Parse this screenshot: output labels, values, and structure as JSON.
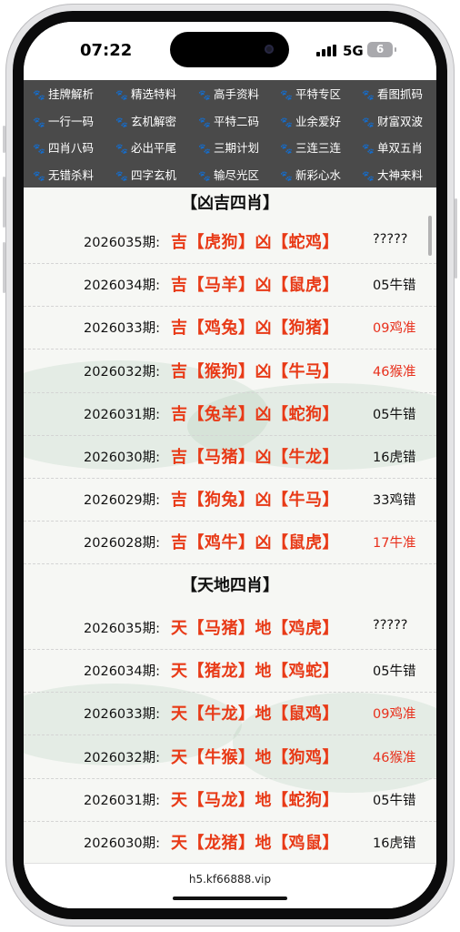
{
  "status_bar": {
    "time": "07:22",
    "network": "5G",
    "battery": "6"
  },
  "nav_menu": [
    [
      "挂牌解析",
      "精选特料",
      "高手资料",
      "平特专区",
      "看图抓码"
    ],
    [
      "一行一码",
      "玄机解密",
      "平特二码",
      "业余爱好",
      "财富双波"
    ],
    [
      "四肖八码",
      "必出平尾",
      "三期计划",
      "三连三连",
      "单双五肖"
    ],
    [
      "无错杀料",
      "四字玄机",
      "输尽光区",
      "新彩心水",
      "大神来料"
    ]
  ],
  "sections": [
    {
      "title": "【凶吉四肖】",
      "rows": [
        {
          "period": "2026035期:",
          "prediction": "吉【虎狗】凶【蛇鸡】",
          "result": "?????",
          "hit": false
        },
        {
          "period": "2026034期:",
          "prediction": "吉【马羊】凶【鼠虎】",
          "result": "05牛错",
          "hit": false
        },
        {
          "period": "2026033期:",
          "prediction": "吉【鸡兔】凶【狗猪】",
          "result": "09鸡准",
          "hit": true
        },
        {
          "period": "2026032期:",
          "prediction": "吉【猴狗】凶【牛马】",
          "result": "46猴准",
          "hit": true
        },
        {
          "period": "2026031期:",
          "prediction": "吉【兔羊】凶【蛇狗】",
          "result": "05牛错",
          "hit": false
        },
        {
          "period": "2026030期:",
          "prediction": "吉【马猪】凶【牛龙】",
          "result": "16虎错",
          "hit": false
        },
        {
          "period": "2026029期:",
          "prediction": "吉【狗兔】凶【牛马】",
          "result": "33鸡错",
          "hit": false
        },
        {
          "period": "2026028期:",
          "prediction": "吉【鸡牛】凶【鼠虎】",
          "result": "17牛准",
          "hit": true
        }
      ]
    },
    {
      "title": "【天地四肖】",
      "rows": [
        {
          "period": "2026035期:",
          "prediction": "天【马猪】地【鸡虎】",
          "result": "?????",
          "hit": false
        },
        {
          "period": "2026034期:",
          "prediction": "天【猪龙】地【鸡蛇】",
          "result": "05牛错",
          "hit": false
        },
        {
          "period": "2026033期:",
          "prediction": "天【牛龙】地【鼠鸡】",
          "result": "09鸡准",
          "hit": true
        },
        {
          "period": "2026032期:",
          "prediction": "天【牛猴】地【狗鸡】",
          "result": "46猴准",
          "hit": true
        },
        {
          "period": "2026031期:",
          "prediction": "天【马龙】地【蛇狗】",
          "result": "05牛错",
          "hit": false
        },
        {
          "period": "2026030期:",
          "prediction": "天【龙猪】地【鸡鼠】",
          "result": "16虎错",
          "hit": false
        }
      ]
    }
  ],
  "url_bar": {
    "url": "h5.kf66888.vip"
  },
  "colors": {
    "nav_bg": "#4a4a4a",
    "prediction": "#e83a17",
    "hit": "#e8301c",
    "miss": "#111111"
  },
  "icons": {
    "nav_item": "paw-icon"
  }
}
